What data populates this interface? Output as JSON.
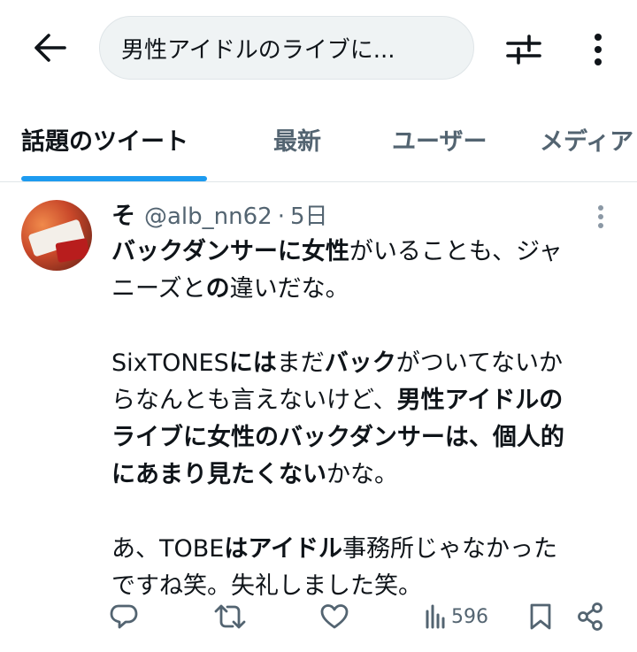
{
  "search": {
    "query": "男性アイドルのライブに..."
  },
  "tabs": [
    {
      "label": "話題のツイート",
      "active": true
    },
    {
      "label": "最新",
      "active": false
    },
    {
      "label": "ユーザー",
      "active": false
    },
    {
      "label": "メディア",
      "active": false
    }
  ],
  "tweet": {
    "display_name": "そ",
    "handle": "@alb_nn62",
    "separator": "·",
    "time": "5日",
    "lines": [
      [
        {
          "t": "バックダンサーに女性",
          "b": true
        },
        {
          "t": "がいることも、ジャ",
          "b": false
        }
      ],
      [
        {
          "t": "ニーズと",
          "b": false
        },
        {
          "t": "の",
          "b": true
        },
        {
          "t": "違いだな。",
          "b": false
        }
      ],
      [],
      [
        {
          "t": "SixTONES",
          "b": false
        },
        {
          "t": "には",
          "b": true
        },
        {
          "t": "まだ",
          "b": false
        },
        {
          "t": "バック",
          "b": true
        },
        {
          "t": "がついてないか",
          "b": false
        }
      ],
      [
        {
          "t": "らなんとも言えないけど、",
          "b": false
        },
        {
          "t": "男性アイドルの",
          "b": true
        }
      ],
      [
        {
          "t": "ライブに女性のバックダンサーは、個人的",
          "b": true
        }
      ],
      [
        {
          "t": "にあまり見たくない",
          "b": true
        },
        {
          "t": "かな。",
          "b": false
        }
      ],
      [],
      [
        {
          "t": "あ、TOBE",
          "b": false
        },
        {
          "t": "はアイドル",
          "b": true
        },
        {
          "t": "事務所じゃなかった",
          "b": false
        }
      ],
      [
        {
          "t": "ですね笑。失礼しました笑。",
          "b": false
        }
      ]
    ],
    "views": "596"
  },
  "colors": {
    "accent": "#1d9bf0",
    "text": "#0f1419",
    "secondary": "#536471",
    "search_bg": "#eff3f4"
  },
  "icons": {
    "back": "arrow-left-icon",
    "filter": "sliders-icon",
    "more": "more-vertical-icon",
    "reply": "reply-icon",
    "retweet": "retweet-icon",
    "like": "heart-icon",
    "views": "views-bar-chart-icon",
    "bookmark": "bookmark-icon",
    "share": "share-icon"
  }
}
